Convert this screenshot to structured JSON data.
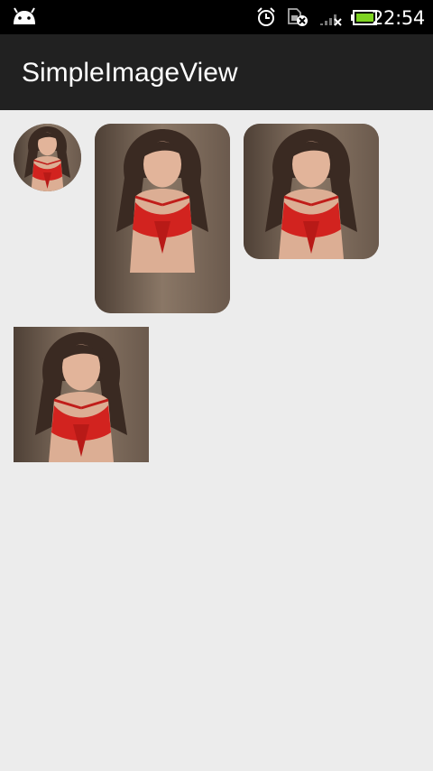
{
  "status_bar": {
    "time": "22:54",
    "icons": [
      "android-icon",
      "alarm-icon",
      "sim-card-error-icon",
      "signal-no-service-icon",
      "battery-charging-icon"
    ],
    "colors": {
      "background": "#000000",
      "battery_fill": "#7ed321"
    }
  },
  "action_bar": {
    "title": "SimpleImageView",
    "background": "#212121"
  },
  "images": [
    {
      "shape": "circle"
    },
    {
      "shape": "rounded-rect"
    },
    {
      "shape": "rounded-rect"
    },
    {
      "shape": "square"
    }
  ],
  "colors": {
    "page_background": "#ececec"
  }
}
